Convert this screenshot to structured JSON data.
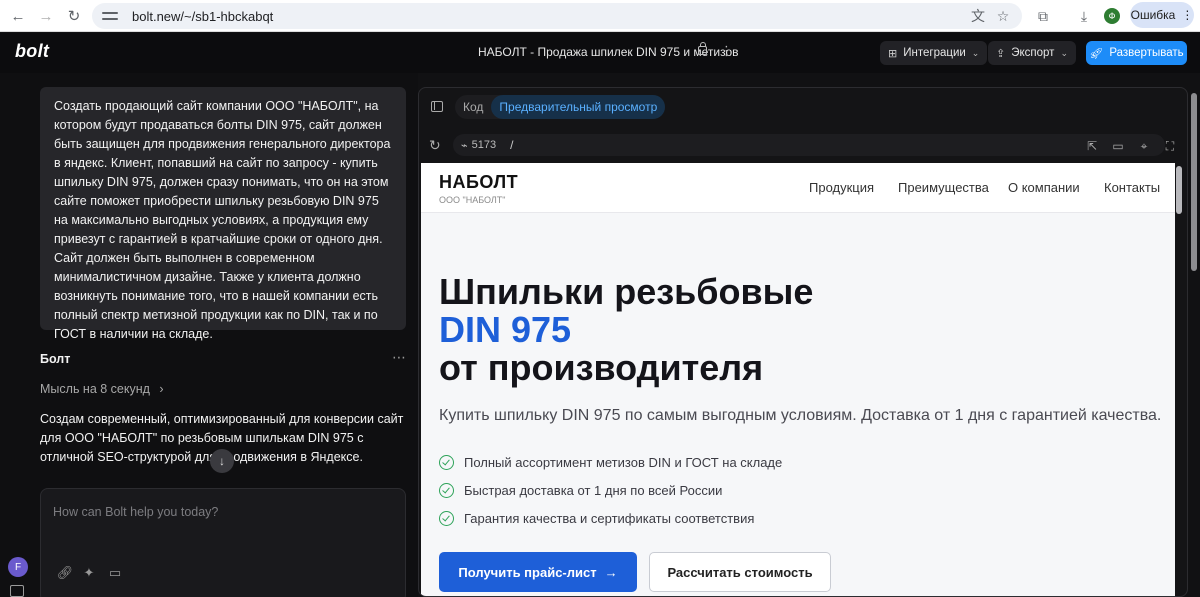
{
  "browser": {
    "url": "bolt.new/~/sb1-hbckabqt",
    "profile_initial": "Ф",
    "error_label": "Ошибка"
  },
  "app": {
    "logo": "bolt",
    "project_title": "НАБОЛТ - Продажа шпилек DIN 975 и метизов",
    "integrations_label": "Интеграции",
    "export_label": "Экспорт",
    "deploy_label": "Развертывать"
  },
  "chat": {
    "user_message": "Создать продающий сайт компании ООО \"НАБОЛТ\", на котором будут продаваться болты DIN 975, сайт должен быть защищен для продвижения генерального директора в яндекс. Клиент, попавший на сайт по запросу - купить шпильку DIN 975, должен сразу понимать, что он на этом сайте поможет приобрести шпильку резьбовую DIN 975 на максимально выгодных условиях, а продукция ему привезут с гарантией в кратчайшие сроки от одного дня. Сайт должен быть выполнен в современном минималистичном дизайне. Также у клиента должно возникнуть понимание того, что в нашей компании есть полный спектр метизной продукции как по DIN, так и по ГОСТ в наличии на складе.",
    "assistant_name": "Болт",
    "thought_label": "Мысль на 8 секунд",
    "assistant_response": "Создам современный, оптимизированный для конверсии сайт для ООО \"НАБОЛТ\" по резьбовым шпилькам DIN 975 с отличной SEO-структурой для продвижения в Яндексе.",
    "input_placeholder": "How can Bolt help you today?",
    "user_avatar": "F"
  },
  "preview": {
    "tab_code": "Код",
    "tab_preview": "Предварительный просмотр",
    "port": "5173",
    "path": "/"
  },
  "site": {
    "brand": "НАБОЛТ",
    "brand_sub": "ООО \"НАБОЛТ\"",
    "nav": [
      "Продукция",
      "Преимущества",
      "О компании",
      "Контакты"
    ],
    "hero_line1": "Шпильки резьбовые",
    "hero_line2": "DIN 975",
    "hero_line3": "от производителя",
    "lead": "Купить шпильку DIN 975 по самым выгодным условиям. Доставка от 1 дня с гарантией качества.",
    "features": [
      "Полный ассортимент метизов DIN и ГОСТ на складе",
      "Быстрая доставка от 1 дня по всей России",
      "Гарантия качества и сертификаты соответствия"
    ],
    "primary_button": "Получить прайс-лист",
    "secondary_button": "Рассчитать стоимость"
  },
  "colors": {
    "accent_blue": "#1e5fd8",
    "deploy_blue": "#1d8cf8",
    "check_green": "#2fa35a"
  }
}
